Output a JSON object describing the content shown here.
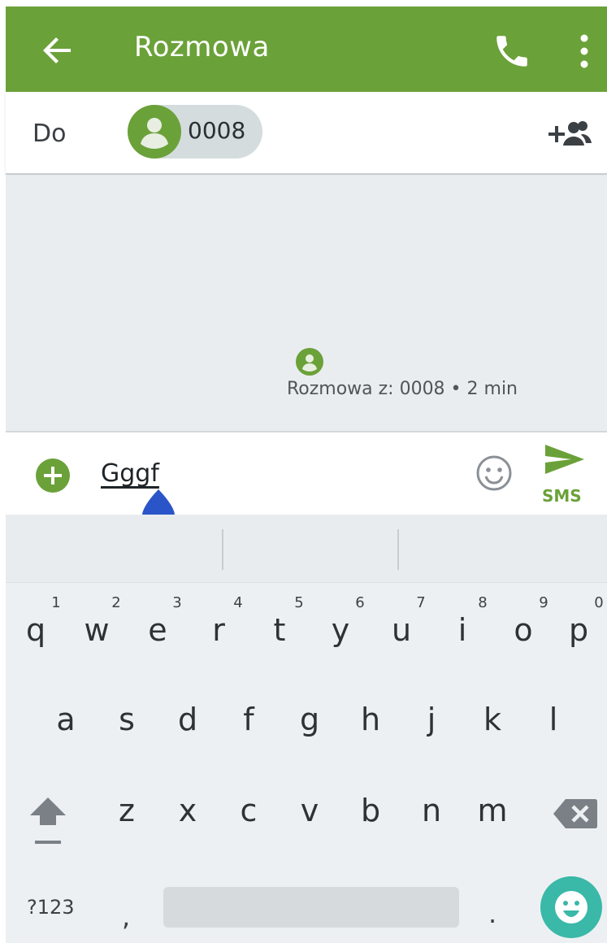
{
  "appbar": {
    "title": "Rozmowa"
  },
  "recipients": {
    "label": "Do",
    "chip_number": "0008"
  },
  "conversation": {
    "meta": "Rozmowa z: 0008 • 2 min"
  },
  "compose": {
    "text": "Gggf",
    "send_label": "SMS"
  },
  "keyboard": {
    "row1": [
      "q",
      "w",
      "e",
      "r",
      "t",
      "y",
      "u",
      "i",
      "o",
      "p"
    ],
    "row1_hints": [
      "1",
      "2",
      "3",
      "4",
      "5",
      "6",
      "7",
      "8",
      "9",
      "0"
    ],
    "row2": [
      "a",
      "s",
      "d",
      "f",
      "g",
      "h",
      "j",
      "k",
      "l"
    ],
    "row3": [
      "z",
      "x",
      "c",
      "v",
      "b",
      "n",
      "m"
    ],
    "symbols_label": "?123",
    "comma": ",",
    "period": "."
  },
  "colors": {
    "accent": "#6ba139",
    "emoji_fab": "#3ab8a8",
    "cursor_handle": "#2a55c9"
  },
  "icons": [
    "back-arrow-icon",
    "phone-icon",
    "more-vert-icon",
    "contact-avatar-icon",
    "add-person-icon",
    "plus-circle-icon",
    "emoji-icon",
    "send-icon",
    "shift-icon",
    "backspace-icon",
    "emoji-keyboard-icon"
  ]
}
